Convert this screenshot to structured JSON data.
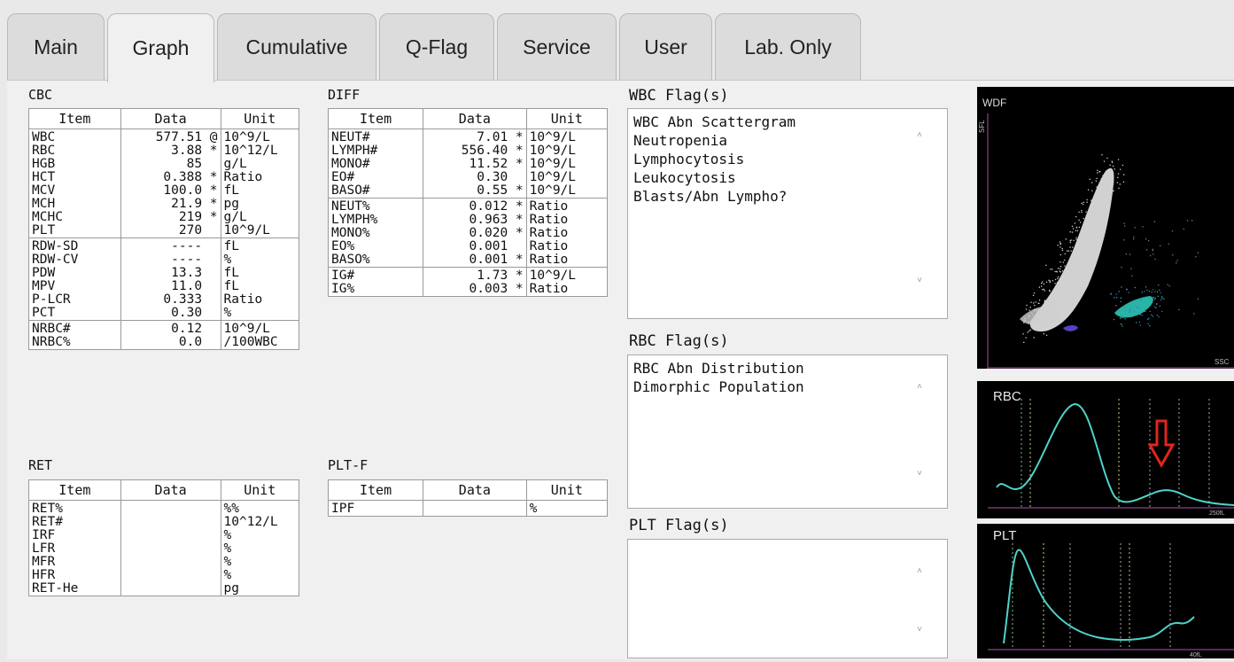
{
  "tabs": [
    {
      "label": "Main"
    },
    {
      "label": "Graph"
    },
    {
      "label": "Cumulative"
    },
    {
      "label": "Q-Flag"
    },
    {
      "label": "Service"
    },
    {
      "label": "User"
    },
    {
      "label": "Lab. Only"
    }
  ],
  "active_tab": "Graph",
  "cbc": {
    "title": "CBC",
    "headers": [
      "Item",
      "Data",
      "Unit"
    ],
    "groups": [
      [
        [
          "WBC",
          "577.51 @",
          "10^9/L"
        ],
        [
          "RBC",
          "3.88 *",
          "10^12/L"
        ],
        [
          "HGB",
          "85  ",
          "g/L"
        ],
        [
          "HCT",
          "0.388 *",
          "Ratio"
        ],
        [
          "MCV",
          "100.0 *",
          "fL"
        ],
        [
          "MCH",
          "21.9 *",
          "pg"
        ],
        [
          "MCHC",
          "219 *",
          "g/L"
        ],
        [
          "PLT",
          "270  ",
          "10^9/L"
        ]
      ],
      [
        [
          "RDW-SD",
          "----  ",
          "fL"
        ],
        [
          "RDW-CV",
          "----  ",
          "%"
        ],
        [
          "PDW",
          "13.3  ",
          "fL"
        ],
        [
          "MPV",
          "11.0  ",
          "fL"
        ],
        [
          "P-LCR",
          "0.333  ",
          "Ratio"
        ],
        [
          "PCT",
          "0.30  ",
          "%"
        ]
      ],
      [
        [
          "NRBC#",
          "0.12  ",
          "10^9/L"
        ],
        [
          "NRBC%",
          "0.0  ",
          "/100WBC"
        ]
      ]
    ]
  },
  "diff": {
    "title": "DIFF",
    "headers": [
      "Item",
      "Data",
      "Unit"
    ],
    "groups": [
      [
        [
          "NEUT#",
          "7.01 *",
          "10^9/L"
        ],
        [
          "LYMPH#",
          "556.40 *",
          "10^9/L"
        ],
        [
          "MONO#",
          "11.52 *",
          "10^9/L"
        ],
        [
          "EO#",
          "0.30  ",
          "10^9/L"
        ],
        [
          "BASO#",
          "0.55 *",
          "10^9/L"
        ]
      ],
      [
        [
          "NEUT%",
          "0.012 *",
          "Ratio"
        ],
        [
          "LYMPH%",
          "0.963 *",
          "Ratio"
        ],
        [
          "MONO%",
          "0.020 *",
          "Ratio"
        ],
        [
          "EO%",
          "0.001  ",
          "Ratio"
        ],
        [
          "BASO%",
          "0.001 *",
          "Ratio"
        ]
      ],
      [
        [
          "IG#",
          "1.73 *",
          "10^9/L"
        ],
        [
          "IG%",
          "0.003 *",
          "Ratio"
        ]
      ]
    ]
  },
  "ret": {
    "title": "RET",
    "headers": [
      "Item",
      "Data",
      "Unit"
    ],
    "groups": [
      [
        [
          "RET%",
          "",
          "%%"
        ],
        [
          "RET#",
          "",
          "10^12/L"
        ],
        [
          "IRF",
          "",
          "%"
        ],
        [
          "LFR",
          "",
          "%"
        ],
        [
          "MFR",
          "",
          "%"
        ],
        [
          "HFR",
          "",
          "%"
        ],
        [
          "RET-He",
          "",
          "pg"
        ]
      ]
    ]
  },
  "pltf": {
    "title": "PLT-F",
    "headers": [
      "Item",
      "Data",
      "Unit"
    ],
    "groups": [
      [
        [
          "IPF",
          "",
          "%"
        ]
      ]
    ]
  },
  "wbc_flags": {
    "title": "WBC Flag(s)",
    "lines": [
      "WBC Abn Scattergram",
      "Neutropenia",
      "Lymphocytosis",
      "Leukocytosis",
      "Blasts/Abn Lympho?"
    ]
  },
  "rbc_flags": {
    "title": "RBC Flag(s)",
    "lines": [
      "RBC Abn Distribution",
      "Dimorphic Population"
    ]
  },
  "plt_flags": {
    "title": "PLT Flag(s)",
    "lines": []
  },
  "scroll_up": "˄",
  "scroll_down": "˅",
  "plots": {
    "wdf": {
      "label": "WDF",
      "y_axis": "SFL",
      "x_axis": "SSC"
    },
    "rbc": {
      "label": "RBC",
      "x_max": "250fL"
    },
    "plt": {
      "label": "PLT",
      "x_max": "40fL"
    }
  },
  "colors": {
    "histogram": "#4fd3c8",
    "axis": "#b14fb0",
    "arrow": "#e0261b",
    "cluster_main": "#e8e8e8",
    "cluster_cyan": "#2fd3c4"
  }
}
